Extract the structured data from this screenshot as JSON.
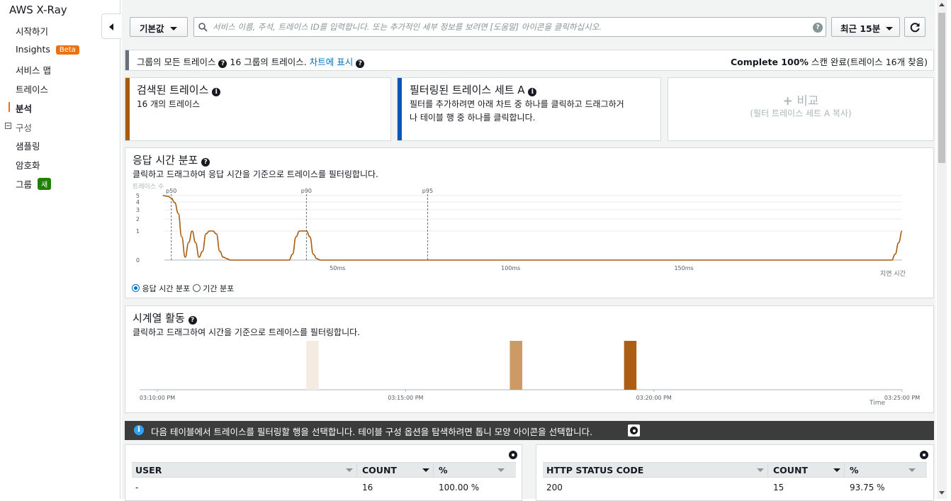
{
  "sidebar": {
    "title": "AWS X-Ray",
    "items": [
      {
        "label": "시작하기"
      },
      {
        "label": "Insights",
        "badge": "Beta"
      },
      {
        "label": "서비스 맵"
      },
      {
        "label": "트레이스"
      },
      {
        "label": "분석"
      },
      {
        "label": "구성"
      },
      {
        "label": "샘플링"
      },
      {
        "label": "암호화"
      },
      {
        "label": "그룹",
        "badge": "새"
      }
    ]
  },
  "toolbar": {
    "group_select": "기본값",
    "search_placeholder": "서비스 이름, 주석, 트레이스 ID를 입력합니다. 또는 추가적인 세부 정보를 보려면 [도움말] 아이콘을 클릭하십시오.",
    "time_range": "최근 15분",
    "refresh_icon": "refresh-icon"
  },
  "status_bar": {
    "text": "그룹의 모든 트레이스",
    "group_info": "16 그룹의 트레이스.",
    "chart_link": "차트에 표시",
    "complete_bold": "Complete 100%",
    "complete_rest": "스캔 완료(트레이스 16개 찾음)"
  },
  "cards": {
    "retrieved": {
      "title": "검색된 트레이스",
      "body": "16 개의 트레이스",
      "color": "#a65c0b"
    },
    "filtered": {
      "title": "필터링된 트레이스 세트 A",
      "body1": "필터를 추가하려면 아래 차트 중 하나를 클릭하고 드래그하거",
      "body2": "나 테이블 행 중 하나를 클릭합니다.",
      "color": "#0a55bb"
    },
    "compare": {
      "title": "비교",
      "body": "(필터 트레이스 세트 A 복사)"
    }
  },
  "response_chart": {
    "title": "응답 시간 분포",
    "subtitle": "클릭하고 드래그하여 응답 시간을 기준으로 트레이스를 필터링합니다.",
    "y_label": "트레이스 수",
    "x_label": "지연 시간",
    "radio_options": [
      "응답 시간 분포",
      "기간 분포"
    ],
    "selected_option": "응답 시간 분포"
  },
  "timeline_chart": {
    "title": "시계열 활동",
    "subtitle": "클릭하고 드래그하여 시간을 기준으로 트레이스를 필터링합니다.",
    "x_label": "Time"
  },
  "info_banner": {
    "text": "다음 테이블에서 트레이스를 필터링할 행을 선택합니다. 테이블 구성 옵션을 탐색하려면 톱니 모양 아이콘을 선택합니다."
  },
  "tables": [
    {
      "columns": [
        "USER",
        "COUNT",
        "%"
      ],
      "rows": [
        [
          "-",
          "16",
          "100.00 %"
        ]
      ]
    },
    {
      "columns": [
        "HTTP STATUS CODE",
        "COUNT",
        "%"
      ],
      "rows": [
        [
          "200",
          "15",
          "93.75 %"
        ]
      ]
    }
  ],
  "chart_data": [
    {
      "type": "line",
      "title": "응답 시간 분포",
      "ylabel": "트레이스 수",
      "xlabel": "지연 시간",
      "x_unit": "ms",
      "x_ticks": [
        50,
        100,
        150
      ],
      "x_tick_labels": [
        "50ms",
        "100ms",
        "150ms"
      ],
      "y_ticks": [
        0,
        1,
        2,
        3,
        4,
        5
      ],
      "xlim": [
        0,
        213
      ],
      "ylim": [
        0,
        5
      ],
      "percentiles": [
        {
          "name": "p50",
          "x": 2
        },
        {
          "name": "p90",
          "x": 41
        },
        {
          "name": "p95",
          "x": 76
        }
      ],
      "series": [
        {
          "color": "#a65c0b",
          "x": [
            -0.5,
            1,
            2,
            3,
            4,
            5,
            6,
            7,
            8,
            9,
            10,
            11,
            12,
            13,
            14,
            15,
            16,
            17,
            18,
            19,
            20,
            36,
            37,
            38,
            39,
            40,
            41,
            42,
            43,
            44,
            45,
            46,
            210,
            211,
            212,
            213
          ],
          "y": [
            5,
            4.9,
            4.6,
            3.9,
            2.6,
            0.8,
            0.1,
            0.6,
            1,
            0.6,
            0.1,
            0.3,
            0.9,
            1,
            1,
            0.9,
            0.3,
            0.1,
            0.05,
            0,
            0,
            0,
            0.2,
            0.8,
            1,
            1,
            1,
            0.8,
            0.2,
            0.05,
            0,
            0,
            0,
            0.2,
            0.6,
            1
          ]
        }
      ]
    },
    {
      "type": "bar",
      "title": "시계열 활동",
      "xlabel": "Time",
      "x_tick_labels": [
        "03:10:00 PM",
        "03:15:00 PM",
        "03:20:00 PM",
        "03:25:00 PM"
      ],
      "xlim_minutes": [
        0,
        15
      ],
      "bars": [
        {
          "x_minutes": 3.0,
          "width_minutes": 0.25,
          "value": 1,
          "color": "#f4ebe3"
        },
        {
          "x_minutes": 7.1,
          "width_minutes": 0.25,
          "value": 1,
          "color": "#cd9965"
        },
        {
          "x_minutes": 9.4,
          "width_minutes": 0.25,
          "value": 1,
          "color": "#ae5e14"
        }
      ]
    }
  ]
}
